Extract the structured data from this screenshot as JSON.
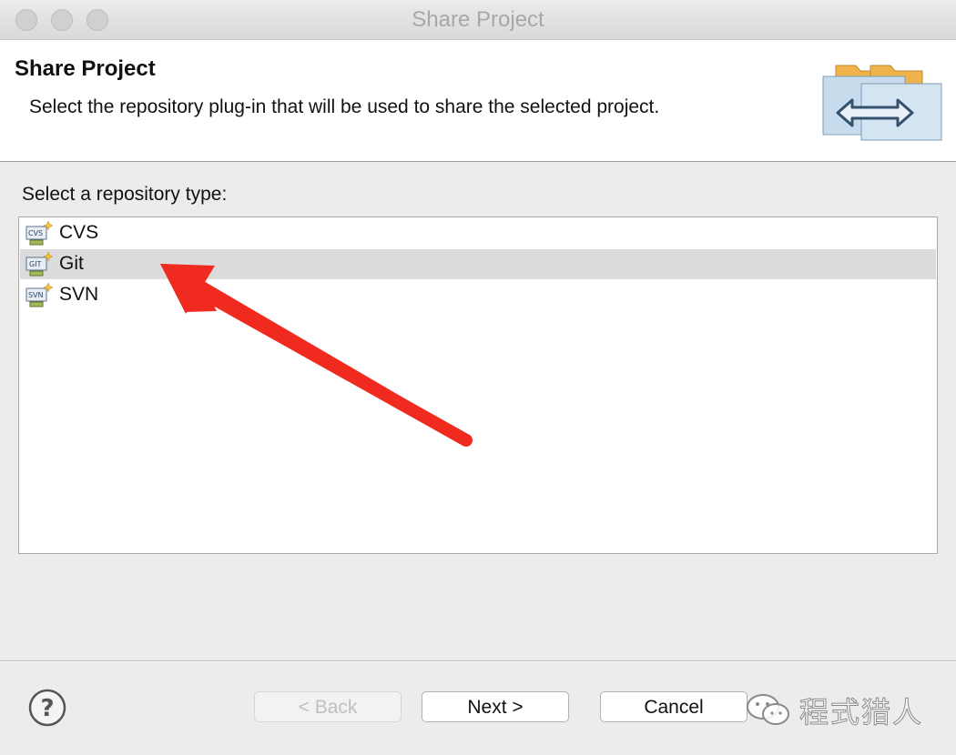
{
  "window": {
    "title": "Share Project"
  },
  "header": {
    "title": "Share Project",
    "description": "Select the repository plug-in that will be used to share the selected project.",
    "banner_icon": "share-project-banner-icon"
  },
  "repository": {
    "label": "Select a repository type:",
    "items": [
      {
        "label": "CVS",
        "icon": "cvs-icon",
        "selected": false
      },
      {
        "label": "Git",
        "icon": "git-icon",
        "selected": true
      },
      {
        "label": "SVN",
        "icon": "svn-icon",
        "selected": false
      }
    ]
  },
  "buttons": {
    "back": "< Back",
    "next": "Next >",
    "cancel": "Cancel",
    "help_icon": "help-icon"
  },
  "watermark": {
    "text": "程式猎人"
  },
  "colors": {
    "annotation_arrow": "#f02a1e",
    "selected_row": "#dcdcdc"
  }
}
